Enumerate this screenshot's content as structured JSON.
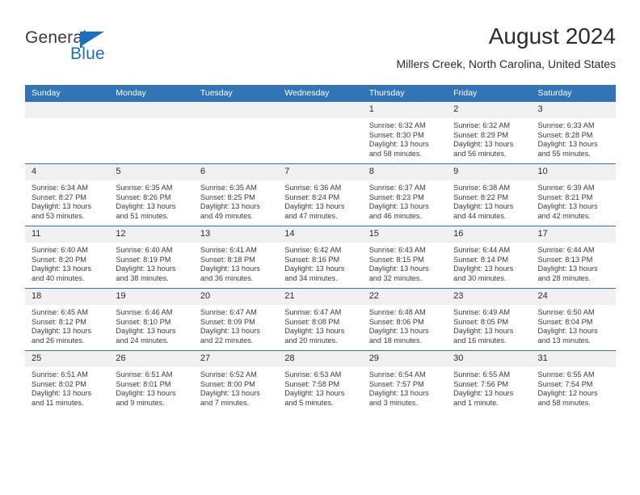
{
  "brand": {
    "name_part1": "General",
    "name_part2": "Blue",
    "accent_color": "#1b6fc1"
  },
  "header": {
    "title": "August 2024",
    "subtitle": "Millers Creek, North Carolina, United States"
  },
  "calendar": {
    "header_color": "#3275b6",
    "daynum_band_color": "#f0f0f0",
    "weekday_headers": [
      "Sunday",
      "Monday",
      "Tuesday",
      "Wednesday",
      "Thursday",
      "Friday",
      "Saturday"
    ],
    "labels": {
      "sunrise": "Sunrise:",
      "sunset": "Sunset:",
      "daylight": "Daylight:"
    },
    "weeks": [
      [
        {
          "day": "",
          "empty": true
        },
        {
          "day": "",
          "empty": true
        },
        {
          "day": "",
          "empty": true
        },
        {
          "day": "",
          "empty": true
        },
        {
          "day": "1",
          "sunrise": "Sunrise: 6:32 AM",
          "sunset": "Sunset: 8:30 PM",
          "daylight": "Daylight: 13 hours and 58 minutes."
        },
        {
          "day": "2",
          "sunrise": "Sunrise: 6:32 AM",
          "sunset": "Sunset: 8:29 PM",
          "daylight": "Daylight: 13 hours and 56 minutes."
        },
        {
          "day": "3",
          "sunrise": "Sunrise: 6:33 AM",
          "sunset": "Sunset: 8:28 PM",
          "daylight": "Daylight: 13 hours and 55 minutes."
        }
      ],
      [
        {
          "day": "4",
          "sunrise": "Sunrise: 6:34 AM",
          "sunset": "Sunset: 8:27 PM",
          "daylight": "Daylight: 13 hours and 53 minutes."
        },
        {
          "day": "5",
          "sunrise": "Sunrise: 6:35 AM",
          "sunset": "Sunset: 8:26 PM",
          "daylight": "Daylight: 13 hours and 51 minutes."
        },
        {
          "day": "6",
          "sunrise": "Sunrise: 6:35 AM",
          "sunset": "Sunset: 8:25 PM",
          "daylight": "Daylight: 13 hours and 49 minutes."
        },
        {
          "day": "7",
          "sunrise": "Sunrise: 6:36 AM",
          "sunset": "Sunset: 8:24 PM",
          "daylight": "Daylight: 13 hours and 47 minutes."
        },
        {
          "day": "8",
          "sunrise": "Sunrise: 6:37 AM",
          "sunset": "Sunset: 8:23 PM",
          "daylight": "Daylight: 13 hours and 46 minutes."
        },
        {
          "day": "9",
          "sunrise": "Sunrise: 6:38 AM",
          "sunset": "Sunset: 8:22 PM",
          "daylight": "Daylight: 13 hours and 44 minutes."
        },
        {
          "day": "10",
          "sunrise": "Sunrise: 6:39 AM",
          "sunset": "Sunset: 8:21 PM",
          "daylight": "Daylight: 13 hours and 42 minutes."
        }
      ],
      [
        {
          "day": "11",
          "sunrise": "Sunrise: 6:40 AM",
          "sunset": "Sunset: 8:20 PM",
          "daylight": "Daylight: 13 hours and 40 minutes."
        },
        {
          "day": "12",
          "sunrise": "Sunrise: 6:40 AM",
          "sunset": "Sunset: 8:19 PM",
          "daylight": "Daylight: 13 hours and 38 minutes."
        },
        {
          "day": "13",
          "sunrise": "Sunrise: 6:41 AM",
          "sunset": "Sunset: 8:18 PM",
          "daylight": "Daylight: 13 hours and 36 minutes."
        },
        {
          "day": "14",
          "sunrise": "Sunrise: 6:42 AM",
          "sunset": "Sunset: 8:16 PM",
          "daylight": "Daylight: 13 hours and 34 minutes."
        },
        {
          "day": "15",
          "sunrise": "Sunrise: 6:43 AM",
          "sunset": "Sunset: 8:15 PM",
          "daylight": "Daylight: 13 hours and 32 minutes."
        },
        {
          "day": "16",
          "sunrise": "Sunrise: 6:44 AM",
          "sunset": "Sunset: 8:14 PM",
          "daylight": "Daylight: 13 hours and 30 minutes."
        },
        {
          "day": "17",
          "sunrise": "Sunrise: 6:44 AM",
          "sunset": "Sunset: 8:13 PM",
          "daylight": "Daylight: 13 hours and 28 minutes."
        }
      ],
      [
        {
          "day": "18",
          "sunrise": "Sunrise: 6:45 AM",
          "sunset": "Sunset: 8:12 PM",
          "daylight": "Daylight: 13 hours and 26 minutes."
        },
        {
          "day": "19",
          "sunrise": "Sunrise: 6:46 AM",
          "sunset": "Sunset: 8:10 PM",
          "daylight": "Daylight: 13 hours and 24 minutes."
        },
        {
          "day": "20",
          "sunrise": "Sunrise: 6:47 AM",
          "sunset": "Sunset: 8:09 PM",
          "daylight": "Daylight: 13 hours and 22 minutes."
        },
        {
          "day": "21",
          "sunrise": "Sunrise: 6:47 AM",
          "sunset": "Sunset: 8:08 PM",
          "daylight": "Daylight: 13 hours and 20 minutes."
        },
        {
          "day": "22",
          "sunrise": "Sunrise: 6:48 AM",
          "sunset": "Sunset: 8:06 PM",
          "daylight": "Daylight: 13 hours and 18 minutes."
        },
        {
          "day": "23",
          "sunrise": "Sunrise: 6:49 AM",
          "sunset": "Sunset: 8:05 PM",
          "daylight": "Daylight: 13 hours and 16 minutes."
        },
        {
          "day": "24",
          "sunrise": "Sunrise: 6:50 AM",
          "sunset": "Sunset: 8:04 PM",
          "daylight": "Daylight: 13 hours and 13 minutes."
        }
      ],
      [
        {
          "day": "25",
          "sunrise": "Sunrise: 6:51 AM",
          "sunset": "Sunset: 8:02 PM",
          "daylight": "Daylight: 13 hours and 11 minutes."
        },
        {
          "day": "26",
          "sunrise": "Sunrise: 6:51 AM",
          "sunset": "Sunset: 8:01 PM",
          "daylight": "Daylight: 13 hours and 9 minutes."
        },
        {
          "day": "27",
          "sunrise": "Sunrise: 6:52 AM",
          "sunset": "Sunset: 8:00 PM",
          "daylight": "Daylight: 13 hours and 7 minutes."
        },
        {
          "day": "28",
          "sunrise": "Sunrise: 6:53 AM",
          "sunset": "Sunset: 7:58 PM",
          "daylight": "Daylight: 13 hours and 5 minutes."
        },
        {
          "day": "29",
          "sunrise": "Sunrise: 6:54 AM",
          "sunset": "Sunset: 7:57 PM",
          "daylight": "Daylight: 13 hours and 3 minutes."
        },
        {
          "day": "30",
          "sunrise": "Sunrise: 6:55 AM",
          "sunset": "Sunset: 7:56 PM",
          "daylight": "Daylight: 13 hours and 1 minute."
        },
        {
          "day": "31",
          "sunrise": "Sunrise: 6:55 AM",
          "sunset": "Sunset: 7:54 PM",
          "daylight": "Daylight: 12 hours and 58 minutes."
        }
      ]
    ]
  }
}
